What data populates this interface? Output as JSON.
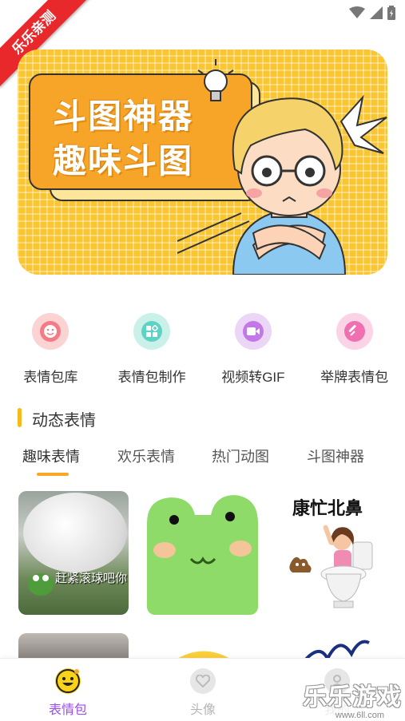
{
  "status_bar": {
    "icons": [
      "wifi-icon",
      "signal-icon",
      "battery-icon"
    ],
    "ribbon_text": "乐乐亲测"
  },
  "banner": {
    "line1": "斗图神器",
    "line2": "趣味斗图",
    "bg_color": "#f9c531",
    "card_color": "#f7a529"
  },
  "quick_actions": [
    {
      "label": "表情包库",
      "icon": "smile-icon",
      "color": "#fbd3d3",
      "inner": "#f47a85"
    },
    {
      "label": "表情包制作",
      "icon": "blocks-icon",
      "color": "#c9f1ea",
      "inner": "#5fd3c3"
    },
    {
      "label": "视频转GIF",
      "icon": "video-icon",
      "color": "#ecd6f7",
      "inner": "#c278e6"
    },
    {
      "label": "举牌表情包",
      "icon": "sign-icon",
      "color": "#fbd3e6",
      "inner": "#ef6fb0"
    }
  ],
  "section": {
    "title": "动态表情"
  },
  "tabs": [
    {
      "label": "趣味表情",
      "active": true
    },
    {
      "label": "欢乐表情",
      "active": false
    },
    {
      "label": "热门动图",
      "active": false
    },
    {
      "label": "斗图神器",
      "active": false
    }
  ],
  "grid": {
    "cell1_caption": "赶紧滚球吧你",
    "cell3_title": "康忙北鼻"
  },
  "bottom_nav": [
    {
      "label": "表情包",
      "icon": "emoji-icon",
      "active": true
    },
    {
      "label": "头像",
      "icon": "heart-icon",
      "active": false
    },
    {
      "label": "我的",
      "icon": "user-icon",
      "active": false
    }
  ],
  "watermark": {
    "text": "乐乐游戏",
    "url": "www.6ll.com"
  },
  "colors": {
    "accent": "#f9a825",
    "active_nav": "#9b4de8",
    "inactive_nav": "#b5b5b5"
  }
}
